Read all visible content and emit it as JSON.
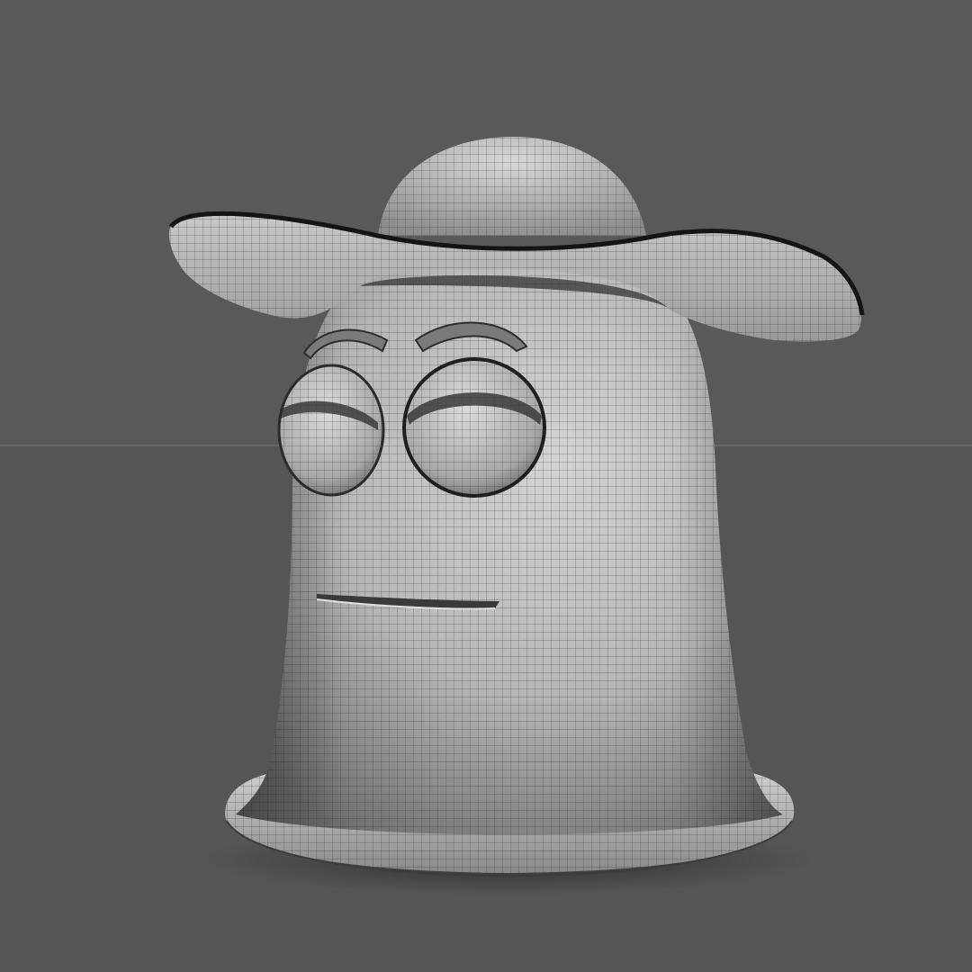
{
  "scene": {
    "colors": {
      "backdrop_upper": "#595959",
      "backdrop_lower": "#555555",
      "horizon_line": "#6e6e6e",
      "clay_light": "#cfcfcf",
      "clay_mid": "#a9a9a9",
      "clay_dark": "#6a6a6a",
      "wire": "#2a2a2a",
      "brim_edge": "#1a1a1a"
    },
    "icons": [
      "clay-bell-character",
      "cowboy-hat",
      "eyeball",
      "eyebrow",
      "mouth-slit"
    ]
  }
}
